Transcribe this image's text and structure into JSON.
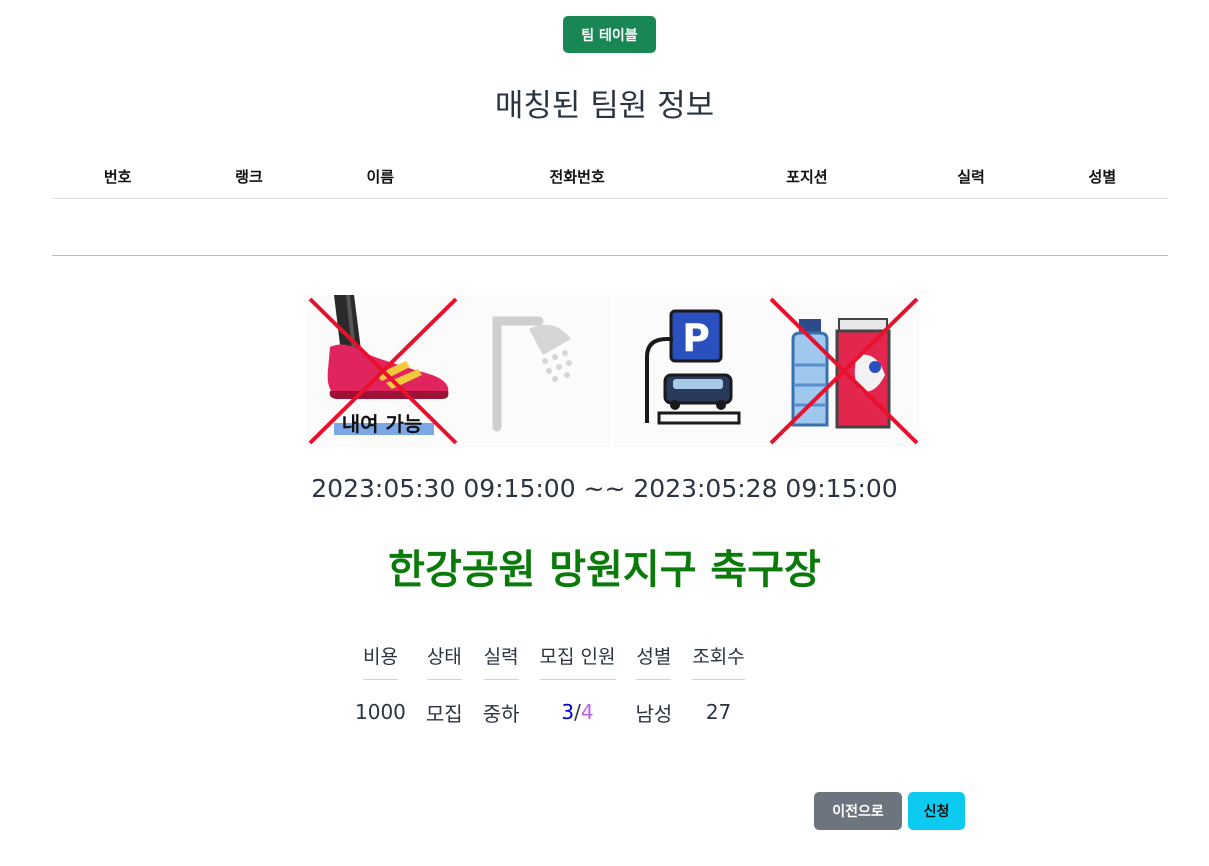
{
  "header": {
    "team_table_button": "팀 테이블",
    "title": "매칭된 팀원 정보"
  },
  "members_table": {
    "columns": [
      "번호",
      "랭크",
      "이름",
      "전화번호",
      "포지션",
      "실력",
      "성별"
    ],
    "rows": []
  },
  "facilities": [
    {
      "icon": "shoe-rental-icon",
      "label": "내여 가능",
      "available": false
    },
    {
      "icon": "shower-icon",
      "available": false
    },
    {
      "icon": "parking-icon",
      "available": true
    },
    {
      "icon": "drinks-icon",
      "available": false
    }
  ],
  "match": {
    "date_range": "2023:05:30 09:15:00 ~~ 2023:05:28 09:15:00",
    "place": "한강공원 망원지구 축구장"
  },
  "info": {
    "headers": {
      "cost": "비용",
      "status": "상태",
      "level": "실력",
      "recruit": "모집 인원",
      "gender": "성별",
      "views": "조회수"
    },
    "values": {
      "cost": "1000",
      "status": "모집",
      "level": "중하",
      "recruit_current": "3",
      "recruit_sep": "/",
      "recruit_total": "4",
      "gender": "남성",
      "views": "27"
    }
  },
  "actions": {
    "back": "이전으로",
    "apply": "신청"
  },
  "colors": {
    "team_button": "#198754",
    "place_name": "#0a7a0a",
    "status": "#dd0000",
    "back_button": "#6c757d",
    "apply_button": "#0dcaf0"
  }
}
